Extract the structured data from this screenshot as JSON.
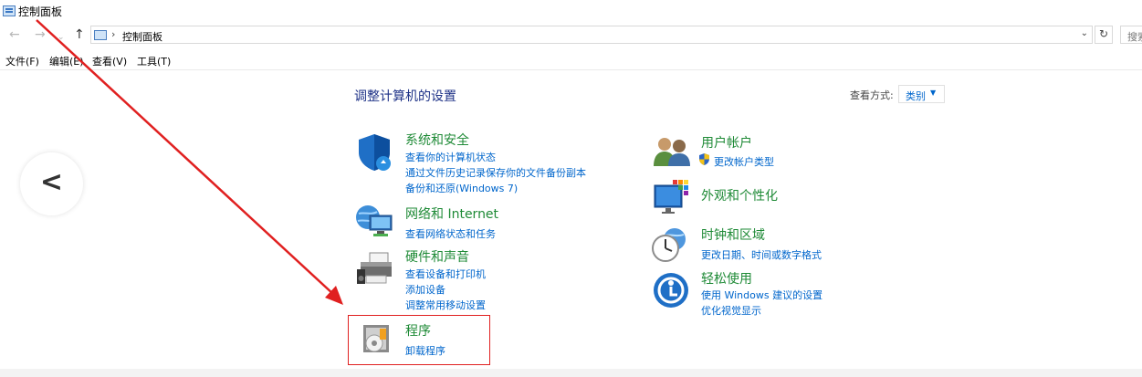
{
  "window": {
    "title": "控制面板"
  },
  "address": {
    "crumb": "控制面板",
    "search_placeholder": "搜索"
  },
  "menu": [
    "文件(F)",
    "编辑(E)",
    "查看(V)",
    "工具(T)"
  ],
  "page": {
    "title": "调整计算机的设置",
    "view_by_label": "查看方式:",
    "view_by_value": "类别"
  },
  "categories": {
    "security": {
      "title": "系统和安全",
      "links": [
        "查看你的计算机状态",
        "通过文件历史记录保存你的文件备份副本",
        "备份和还原(Windows 7)"
      ]
    },
    "network": {
      "title": "网络和 Internet",
      "links": [
        "查看网络状态和任务"
      ]
    },
    "hardware": {
      "title": "硬件和声音",
      "links": [
        "查看设备和打印机",
        "添加设备",
        "调整常用移动设置"
      ]
    },
    "programs": {
      "title": "程序",
      "links": [
        "卸载程序"
      ]
    },
    "users": {
      "title": "用户帐户",
      "links": [
        "更改帐户类型"
      ]
    },
    "appearance": {
      "title": "外观和个性化",
      "links": []
    },
    "clock": {
      "title": "时钟和区域",
      "links": [
        "更改日期、时间或数字格式"
      ]
    },
    "ease": {
      "title": "轻松使用",
      "links": [
        "使用 Windows 建议的设置",
        "优化视觉显示"
      ]
    }
  },
  "colors": {
    "title_blue": "#1e3287",
    "category_green": "#1e8a36",
    "link_blue": "#0066cc",
    "annotation_red": "#e02020"
  }
}
